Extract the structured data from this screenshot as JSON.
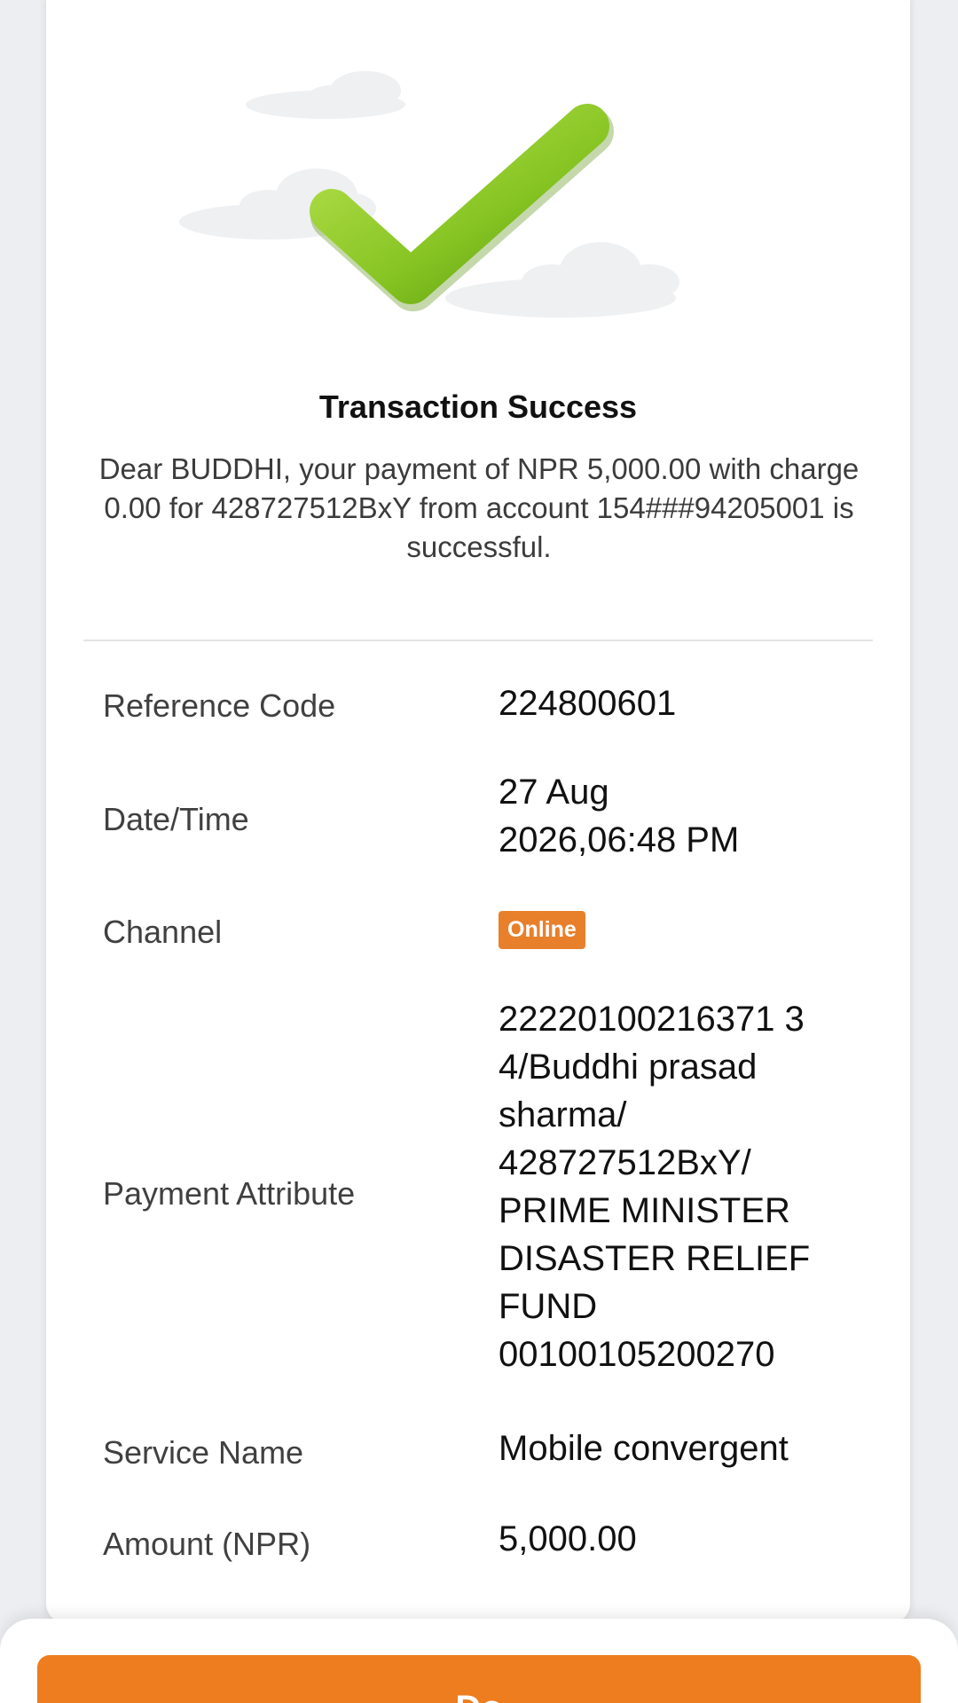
{
  "status": {
    "title": "Transaction Success",
    "message": "Dear BUDDHI, your payment of NPR 5,000.00 with charge 0.00 for 428727512BxY from account 154###94205001 is successful.",
    "icon": "checkmark-icon",
    "icon_color": "#7fbf1d"
  },
  "details": {
    "reference_code": {
      "label": "Reference Code",
      "value": "224800601"
    },
    "date_time": {
      "label": "Date/Time",
      "value": "27 Aug\n2026,06:48 PM"
    },
    "channel": {
      "label": "Channel",
      "value": "Online",
      "badge_color": "#e8802b"
    },
    "payment_attribute": {
      "label": "Payment Attribute",
      "value": "22220100216371 3\n4/Buddhi prasad\nsharma/\n428727512BxY/\nPRIME MINISTER\nDISASTER RELIEF\nFUND\n00100105200270"
    },
    "service_name": {
      "label": "Service Name",
      "value": "Mobile convergent"
    },
    "amount": {
      "label": "Amount (NPR)",
      "value": "5,000.00"
    }
  },
  "footer": {
    "button_label": "Do",
    "button_color": "#ed7d1e"
  }
}
